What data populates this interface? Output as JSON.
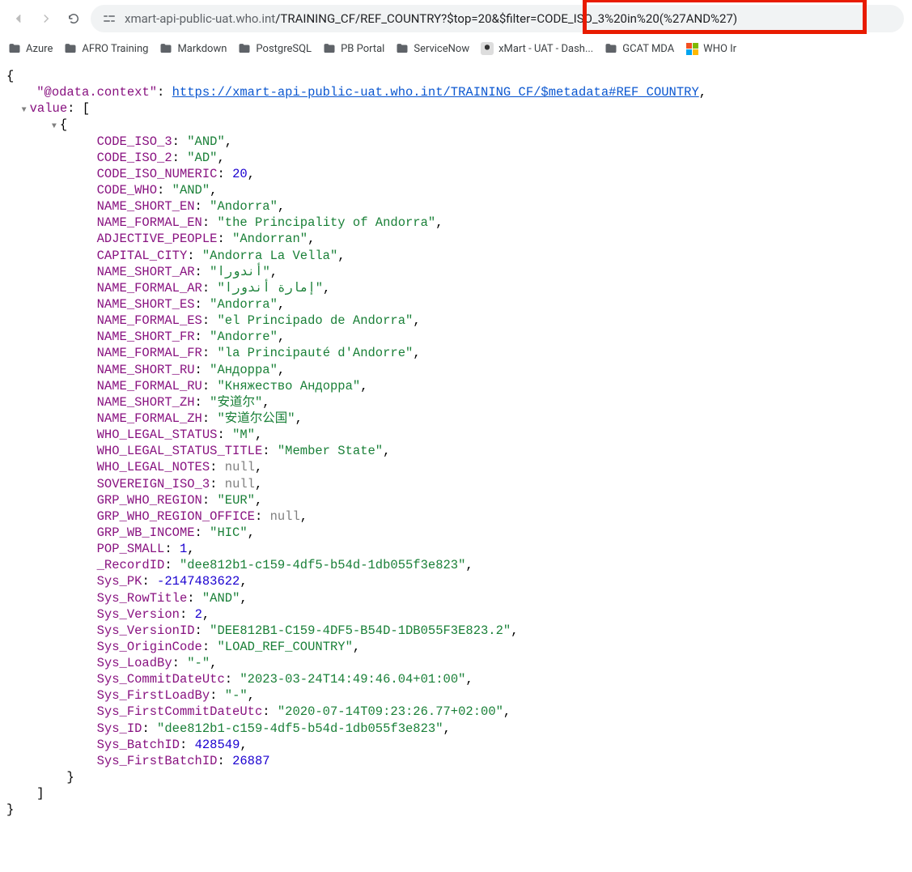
{
  "addressbar": {
    "host": "xmart-api-public-uat.who.int",
    "path": "/TRAINING_CF/REF_COUNTRY?$top=20&$filter=CODE_ISO_3%20in%20(%27AND%27)"
  },
  "bookmarks": [
    {
      "label": "Azure",
      "icon": "folder"
    },
    {
      "label": "AFRO Training",
      "icon": "folder"
    },
    {
      "label": "Markdown",
      "icon": "folder"
    },
    {
      "label": "PostgreSQL",
      "icon": "folder"
    },
    {
      "label": "PB Portal",
      "icon": "folder"
    },
    {
      "label": "ServiceNow",
      "icon": "folder"
    },
    {
      "label": "xMart - UAT - Dash...",
      "icon": "xmart"
    },
    {
      "label": "GCAT MDA",
      "icon": "folder"
    },
    {
      "label": "WHO Ir",
      "icon": "ms"
    }
  ],
  "json": {
    "context_key": "\"@odata.context\"",
    "context_url": "https://xmart-api-public-uat.who.int/TRAINING_CF/$metadata#REF_COUNTRY",
    "value_key": "value",
    "record": [
      {
        "k": "CODE_ISO_3",
        "t": "string",
        "v": "\"AND\""
      },
      {
        "k": "CODE_ISO_2",
        "t": "string",
        "v": "\"AD\""
      },
      {
        "k": "CODE_ISO_NUMERIC",
        "t": "num",
        "v": "20"
      },
      {
        "k": "CODE_WHO",
        "t": "string",
        "v": "\"AND\""
      },
      {
        "k": "NAME_SHORT_EN",
        "t": "string",
        "v": "\"Andorra\""
      },
      {
        "k": "NAME_FORMAL_EN",
        "t": "string",
        "v": "\"the Principality of Andorra\""
      },
      {
        "k": "ADJECTIVE_PEOPLE",
        "t": "string",
        "v": "\"Andorran\""
      },
      {
        "k": "CAPITAL_CITY",
        "t": "string",
        "v": "\"Andorra La Vella\""
      },
      {
        "k": "NAME_SHORT_AR",
        "t": "string",
        "v": "\"أندورا\""
      },
      {
        "k": "NAME_FORMAL_AR",
        "t": "string",
        "v": "\"إمارة أندورا\""
      },
      {
        "k": "NAME_SHORT_ES",
        "t": "string",
        "v": "\"Andorra\""
      },
      {
        "k": "NAME_FORMAL_ES",
        "t": "string",
        "v": "\"el Principado de Andorra\""
      },
      {
        "k": "NAME_SHORT_FR",
        "t": "string",
        "v": "\"Andorre\""
      },
      {
        "k": "NAME_FORMAL_FR",
        "t": "string",
        "v": "\"la Principauté d'Andorre\""
      },
      {
        "k": "NAME_SHORT_RU",
        "t": "string",
        "v": "\"Андорра\""
      },
      {
        "k": "NAME_FORMAL_RU",
        "t": "string",
        "v": "\"Княжество Андорра\""
      },
      {
        "k": "NAME_SHORT_ZH",
        "t": "string",
        "v": "\"安道尔\""
      },
      {
        "k": "NAME_FORMAL_ZH",
        "t": "string",
        "v": "\"安道尔公国\""
      },
      {
        "k": "WHO_LEGAL_STATUS",
        "t": "string",
        "v": "\"M\""
      },
      {
        "k": "WHO_LEGAL_STATUS_TITLE",
        "t": "string",
        "v": "\"Member State\""
      },
      {
        "k": "WHO_LEGAL_NOTES",
        "t": "null",
        "v": "null"
      },
      {
        "k": "SOVEREIGN_ISO_3",
        "t": "null",
        "v": "null"
      },
      {
        "k": "GRP_WHO_REGION",
        "t": "string",
        "v": "\"EUR\""
      },
      {
        "k": "GRP_WHO_REGION_OFFICE",
        "t": "null",
        "v": "null"
      },
      {
        "k": "GRP_WB_INCOME",
        "t": "string",
        "v": "\"HIC\""
      },
      {
        "k": "POP_SMALL",
        "t": "num",
        "v": "1"
      },
      {
        "k": "_RecordID",
        "t": "string",
        "v": "\"dee812b1-c159-4df5-b54d-1db055f3e823\""
      },
      {
        "k": "Sys_PK",
        "t": "num",
        "v": "-2147483622"
      },
      {
        "k": "Sys_RowTitle",
        "t": "string",
        "v": "\"AND\""
      },
      {
        "k": "Sys_Version",
        "t": "num",
        "v": "2"
      },
      {
        "k": "Sys_VersionID",
        "t": "string",
        "v": "\"DEE812B1-C159-4DF5-B54D-1DB055F3E823.2\""
      },
      {
        "k": "Sys_OriginCode",
        "t": "string",
        "v": "\"LOAD_REF_COUNTRY\""
      },
      {
        "k": "Sys_LoadBy",
        "t": "string",
        "v": "\"-\""
      },
      {
        "k": "Sys_CommitDateUtc",
        "t": "string",
        "v": "\"2023-03-24T14:49:46.04+01:00\""
      },
      {
        "k": "Sys_FirstLoadBy",
        "t": "string",
        "v": "\"-\""
      },
      {
        "k": "Sys_FirstCommitDateUtc",
        "t": "string",
        "v": "\"2020-07-14T09:23:26.77+02:00\""
      },
      {
        "k": "Sys_ID",
        "t": "string",
        "v": "\"dee812b1-c159-4df5-b54d-1db055f3e823\""
      },
      {
        "k": "Sys_BatchID",
        "t": "num",
        "v": "428549"
      },
      {
        "k": "Sys_FirstBatchID",
        "t": "num",
        "v": "26887"
      }
    ]
  }
}
